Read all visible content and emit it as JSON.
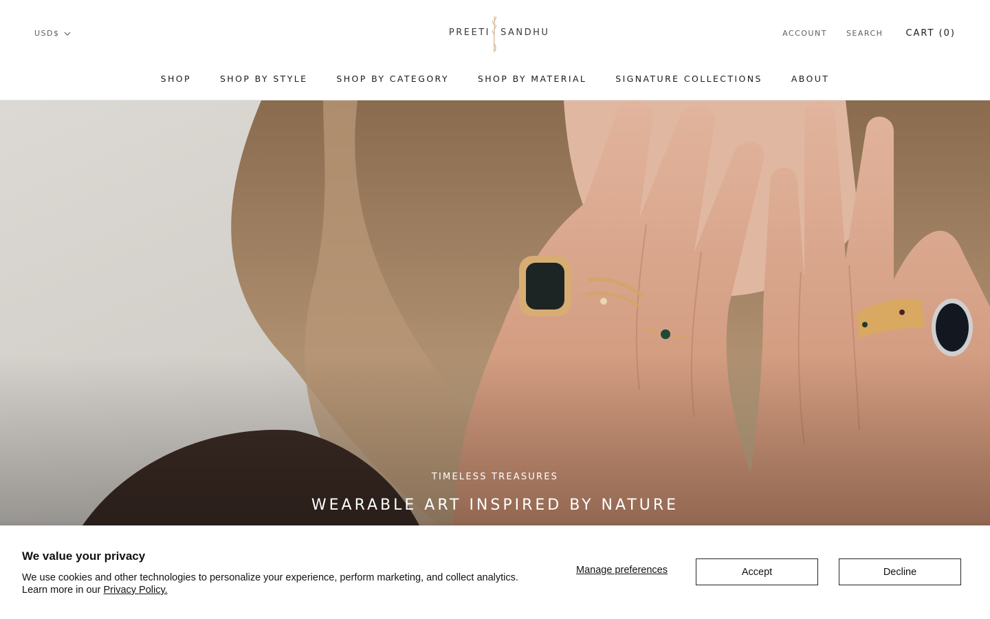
{
  "header": {
    "currency": "USD$",
    "logo_left": "PREETI",
    "logo_right": "SANDHU",
    "account": "Account",
    "search": "Search",
    "cart": "CART (0)"
  },
  "nav": {
    "items": [
      {
        "label": "SHOP"
      },
      {
        "label": "SHOP BY STYLE"
      },
      {
        "label": "SHOP BY CATEGORY"
      },
      {
        "label": "SHOP BY MATERIAL"
      },
      {
        "label": "SIGNATURE COLLECTIONS"
      },
      {
        "label": "ABOUT"
      }
    ]
  },
  "hero": {
    "subtitle": "TIMELESS TREASURES",
    "title": "WEARABLE ART INSPIRED BY NATURE"
  },
  "cookie": {
    "title": "We value your privacy",
    "body_line1": "We use cookies and other technologies to personalize your experience, perform marketing, and collect analytics.",
    "body_line2_prefix": "Learn more in our ",
    "privacy_link": "Privacy Policy.",
    "manage": "Manage preferences",
    "accept": "Accept",
    "decline": "Decline"
  },
  "colors": {
    "text": "#1c1b1b",
    "muted": "#5c5c5c",
    "logo_accent": "#c9a27a",
    "banner_border": "#222222"
  }
}
